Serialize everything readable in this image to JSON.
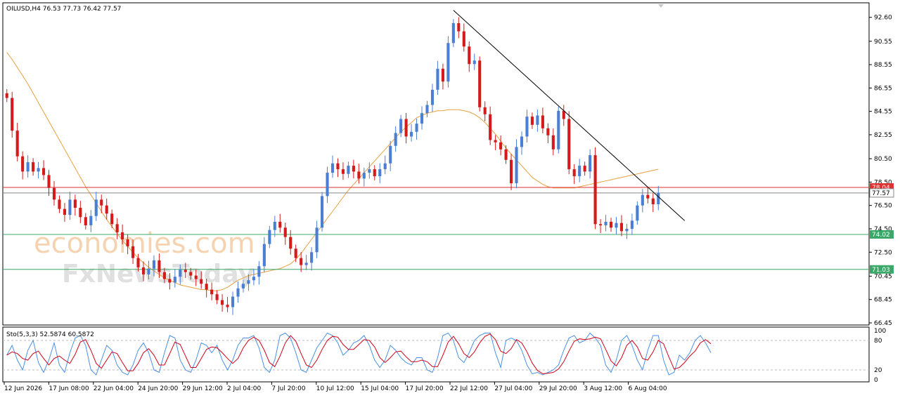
{
  "header": {
    "symbol_text": "OILUSD,H4  76.53 77.73 76.42 77.57"
  },
  "stoch": {
    "label": "Sto(5,3,3) 52.5874 60.5872",
    "levels": [
      "100",
      "80",
      "20",
      "0"
    ],
    "k_color": "#4a90e2",
    "d_color": "#d0021b",
    "k": [
      50,
      70,
      40,
      20,
      60,
      80,
      35,
      15,
      40,
      75,
      30,
      15,
      55,
      85,
      90,
      70,
      20,
      10,
      40,
      70,
      60,
      30,
      15,
      10,
      30,
      60,
      75,
      55,
      20,
      15,
      55,
      90,
      85,
      40,
      20,
      15,
      40,
      75,
      70,
      55,
      70,
      40,
      20,
      40,
      70,
      85,
      85,
      90,
      65,
      25,
      15,
      40,
      90,
      95,
      85,
      55,
      20,
      15,
      40,
      65,
      80,
      95,
      90,
      75,
      50,
      60,
      75,
      80,
      90,
      70,
      40,
      25,
      40,
      70,
      60,
      45,
      35,
      30,
      45,
      45,
      20,
      15,
      45,
      90,
      95,
      80,
      45,
      35,
      55,
      80,
      90,
      95,
      95,
      55,
      25,
      80,
      85,
      80,
      60,
      30,
      12,
      15,
      10,
      15,
      20,
      30,
      60,
      85,
      90,
      75,
      80,
      95,
      85,
      70,
      30,
      15,
      40,
      80,
      90,
      70,
      40,
      20,
      60,
      90,
      90,
      40,
      10,
      15,
      50,
      40,
      55,
      80,
      90,
      75,
      55
    ]
  },
  "watermark": {
    "line1": "economies.com",
    "line2": "FxNewsToday"
  },
  "chart_data": {
    "type": "candlestick",
    "symbol": "OILUSD",
    "timeframe": "H4",
    "ohlc_header": {
      "open": 76.53,
      "high": 77.73,
      "low": 76.42,
      "close": 77.57
    },
    "ylim": [
      66.45,
      93.6
    ],
    "y_ticks": [
      "92.60",
      "90.55",
      "88.55",
      "86.55",
      "84.55",
      "82.55",
      "80.50",
      "78.50",
      "76.50",
      "74.50",
      "72.50",
      "70.45",
      "68.45",
      "66.45"
    ],
    "x_ticks": [
      "12 Jun 2026",
      "17 Jun 08:00",
      "22 Jun 04:00",
      "24 Jun 20:00",
      "29 Jun 12:00",
      "2 Jul 04:00",
      "7 Jul 20:00",
      "10 Jul 12:00",
      "15 Jul 04:00",
      "17 Jul 20:00",
      "22 Jul 12:00",
      "27 Jul 04:00",
      "29 Jul 20:00",
      "3 Aug 12:00",
      "6 Aug 04:00"
    ],
    "up_color": "#4a7fd4",
    "down_color": "#d41a1a",
    "ma_color": "#e8a040",
    "closes": [
      85.7,
      82.9,
      80.7,
      79.4,
      80.2,
      79.4,
      79.7,
      79.1,
      78.0,
      77.0,
      76.2,
      75.7,
      77.0,
      76.3,
      75.5,
      74.8,
      75.6,
      77.0,
      76.5,
      75.8,
      74.9,
      74.2,
      73.6,
      73.0,
      72.0,
      71.2,
      70.6,
      71.1,
      71.8,
      70.8,
      70.2,
      69.9,
      70.4,
      71.0,
      70.8,
      70.5,
      70.2,
      69.8,
      69.3,
      68.9,
      68.4,
      68.0,
      67.8,
      68.7,
      69.4,
      69.8,
      70.1,
      70.4,
      71.3,
      73.2,
      74.4,
      75.1,
      74.6,
      73.8,
      72.8,
      72.0,
      71.4,
      71.6,
      72.5,
      74.6,
      77.3,
      79.3,
      80.1,
      79.6,
      79.2,
      79.9,
      79.4,
      78.8,
      79.3,
      79.6,
      79.0,
      79.6,
      80.1,
      81.6,
      82.7,
      83.9,
      82.4,
      82.8,
      83.5,
      84.4,
      85.1,
      86.4,
      88.2,
      87.1,
      90.4,
      92.1,
      91.4,
      90.1,
      88.6,
      88.9,
      84.9,
      84.3,
      82.1,
      81.9,
      81.3,
      80.4,
      78.4,
      81.5,
      82.4,
      84.1,
      83.4,
      84.2,
      83.1,
      82.5,
      81.3,
      84.6,
      83.9,
      79.6,
      79.0,
      79.9,
      79.4,
      80.8,
      74.9,
      74.8,
      75.1,
      74.6,
      75.0,
      74.3,
      74.5,
      75.2,
      76.5,
      77.4,
      77.1,
      76.6,
      77.57
    ],
    "ma50": [
      89.6,
      89.0,
      88.3,
      87.6,
      86.9,
      86.1,
      85.3,
      84.5,
      83.7,
      82.9,
      82.1,
      81.3,
      80.5,
      79.7,
      78.9,
      78.1,
      77.4,
      76.7,
      76.0,
      75.3,
      74.7,
      74.1,
      73.5,
      73.0,
      72.5,
      72.0,
      71.6,
      71.2,
      70.9,
      70.6,
      70.3,
      70.1,
      69.9,
      69.7,
      69.6,
      69.5,
      69.4,
      69.3,
      69.3,
      69.2,
      69.2,
      69.3,
      69.5,
      69.8,
      70.1,
      70.3,
      70.5,
      70.6,
      70.7,
      70.8,
      70.9,
      71.0,
      71.1,
      71.3,
      71.5,
      71.9,
      72.4,
      73.0,
      73.6,
      74.2,
      74.8,
      75.4,
      76.0,
      76.6,
      77.2,
      77.8,
      78.3,
      78.8,
      79.3,
      79.8,
      80.3,
      80.8,
      81.3,
      81.8,
      82.3,
      82.8,
      83.2,
      83.6,
      84.0,
      84.2,
      84.4,
      84.5,
      84.6,
      84.6,
      84.7,
      84.7,
      84.7,
      84.6,
      84.5,
      84.3,
      84.0,
      83.6,
      83.1,
      82.6,
      82.0,
      81.4,
      80.9,
      80.4,
      79.9,
      79.4,
      78.9,
      78.6,
      78.3,
      78.1,
      78.0,
      78.0,
      78.0,
      78.0,
      78.0,
      78.1,
      78.2,
      78.3,
      78.4,
      78.5,
      78.6,
      78.7,
      78.8,
      78.9,
      79.0,
      79.1,
      79.2,
      79.3,
      79.4,
      79.5,
      79.6
    ],
    "hlines": [
      {
        "value": 78.04,
        "label": "78.04",
        "color": "#e03030",
        "label_bg": "#e03030"
      },
      {
        "value": 77.57,
        "label": "77.57",
        "color": "#888888",
        "label_bg": "#ffffff"
      },
      {
        "value": 74.02,
        "label": "74.02",
        "color": "#3aa868",
        "label_bg": "#3aa868"
      },
      {
        "value": 71.03,
        "label": "71.03",
        "color": "#3aa868",
        "label_bg": "#3aa868"
      }
    ],
    "trendline": {
      "from": {
        "i": 85,
        "v": 93.2
      },
      "to": {
        "i": 125,
        "v": 75.2
      },
      "color": "#000000"
    }
  }
}
